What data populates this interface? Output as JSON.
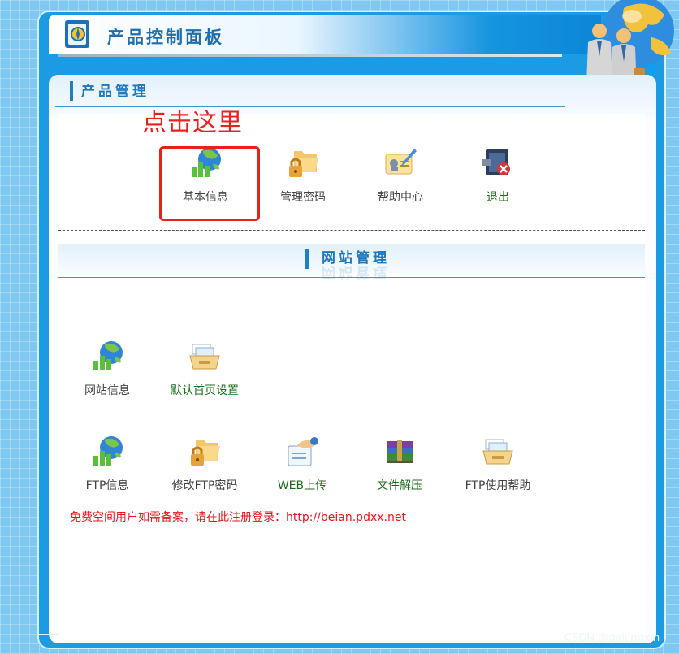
{
  "header": {
    "title": "产品控制面板"
  },
  "product_section": {
    "title": "产品管理",
    "annotation": "点击这里",
    "items": [
      {
        "label": "基本信息",
        "icon": "globe-chart-icon"
      },
      {
        "label": "管理密码",
        "icon": "locked-folder-icon"
      },
      {
        "label": "帮助中心",
        "icon": "id-card-pen-icon"
      },
      {
        "label": "退出",
        "icon": "exit-door-icon"
      }
    ]
  },
  "site_section": {
    "title": "网站管理",
    "row1": [
      {
        "label": "网站信息",
        "icon": "globe-chart-icon"
      },
      {
        "label": "默认首页设置",
        "icon": "file-tray-icon"
      }
    ],
    "row2": [
      {
        "label": "FTP信息",
        "icon": "globe-chart-icon"
      },
      {
        "label": "修改FTP密码",
        "icon": "locked-folder-icon"
      },
      {
        "label": "WEB上传",
        "icon": "upload-hand-icon"
      },
      {
        "label": "文件解压",
        "icon": "archive-books-icon"
      },
      {
        "label": "FTP使用帮助",
        "icon": "file-tray-icon"
      }
    ],
    "notice": "免费空间用户如需备案，请在此注册登录：http://beian.pdxx.net"
  },
  "watermark": "CSDN @daijingxin",
  "colors": {
    "frame": "#1a9be3",
    "accent": "#1e7fc8",
    "annotation": "#e8211c",
    "link_green": "#1b6d1b"
  }
}
